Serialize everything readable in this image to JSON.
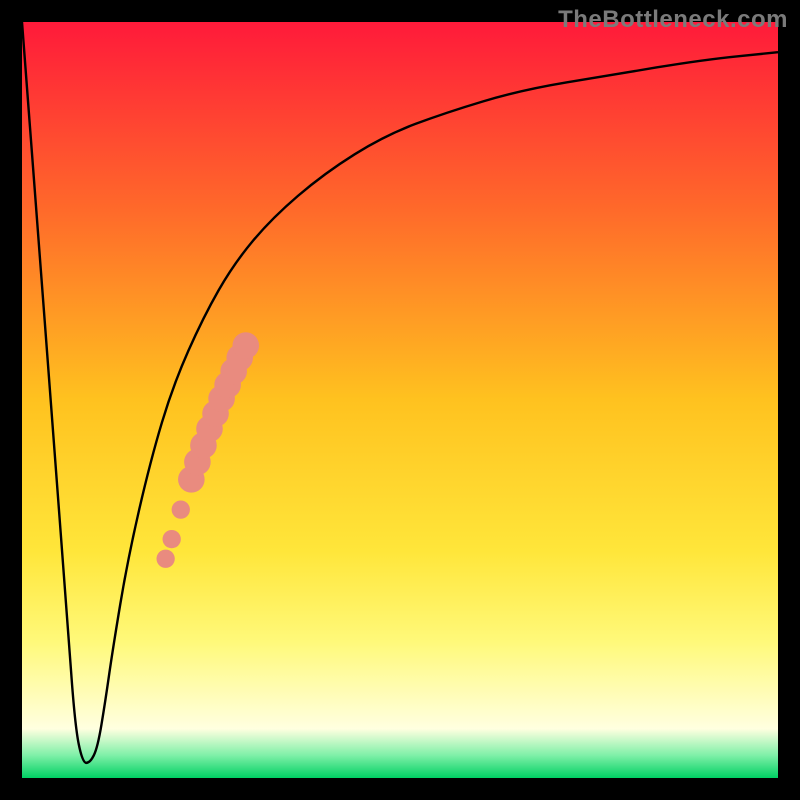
{
  "watermark": "TheBottleneck.com",
  "chart_data": {
    "type": "line",
    "title": "",
    "xlabel": "",
    "ylabel": "",
    "xlim": [
      0,
      100
    ],
    "ylim": [
      0,
      100
    ],
    "grid": false,
    "legend": false,
    "background": {
      "type": "vertical-gradient",
      "stops": [
        {
          "offset": 0.0,
          "color": "#ff1a3a"
        },
        {
          "offset": 0.25,
          "color": "#ff6a2a"
        },
        {
          "offset": 0.5,
          "color": "#ffc21f"
        },
        {
          "offset": 0.7,
          "color": "#ffe63a"
        },
        {
          "offset": 0.82,
          "color": "#fff97a"
        },
        {
          "offset": 0.935,
          "color": "#ffffe0"
        },
        {
          "offset": 0.97,
          "color": "#7ff0a8"
        },
        {
          "offset": 1.0,
          "color": "#00d063"
        }
      ]
    },
    "series": [
      {
        "name": "bottleneck-curve",
        "x": [
          0,
          2,
          4,
          6,
          7,
          8,
          9,
          10,
          11,
          12,
          14,
          17,
          20,
          24,
          28,
          33,
          40,
          48,
          56,
          66,
          78,
          90,
          100
        ],
        "values": [
          100,
          74,
          47,
          21,
          7,
          2,
          2,
          4,
          10,
          17,
          29,
          42,
          52,
          61,
          68,
          74,
          80,
          85,
          88,
          91,
          93,
          95,
          96
        ]
      }
    ],
    "points": {
      "name": "highlighted-segment",
      "color": "#e98b7f",
      "items": [
        {
          "x": 19.0,
          "y": 29.0,
          "r": 2.2
        },
        {
          "x": 19.8,
          "y": 31.6,
          "r": 2.2
        },
        {
          "x": 21.0,
          "y": 35.5,
          "r": 2.2
        },
        {
          "x": 22.4,
          "y": 39.5,
          "r": 3.2
        },
        {
          "x": 23.2,
          "y": 41.8,
          "r": 3.2
        },
        {
          "x": 24.0,
          "y": 44.0,
          "r": 3.2
        },
        {
          "x": 24.8,
          "y": 46.2,
          "r": 3.2
        },
        {
          "x": 25.6,
          "y": 48.2,
          "r": 3.2
        },
        {
          "x": 26.4,
          "y": 50.2,
          "r": 3.2
        },
        {
          "x": 27.2,
          "y": 52.0,
          "r": 3.2
        },
        {
          "x": 28.0,
          "y": 53.8,
          "r": 3.2
        },
        {
          "x": 28.8,
          "y": 55.6,
          "r": 3.2
        },
        {
          "x": 29.6,
          "y": 57.2,
          "r": 3.2
        }
      ]
    }
  }
}
